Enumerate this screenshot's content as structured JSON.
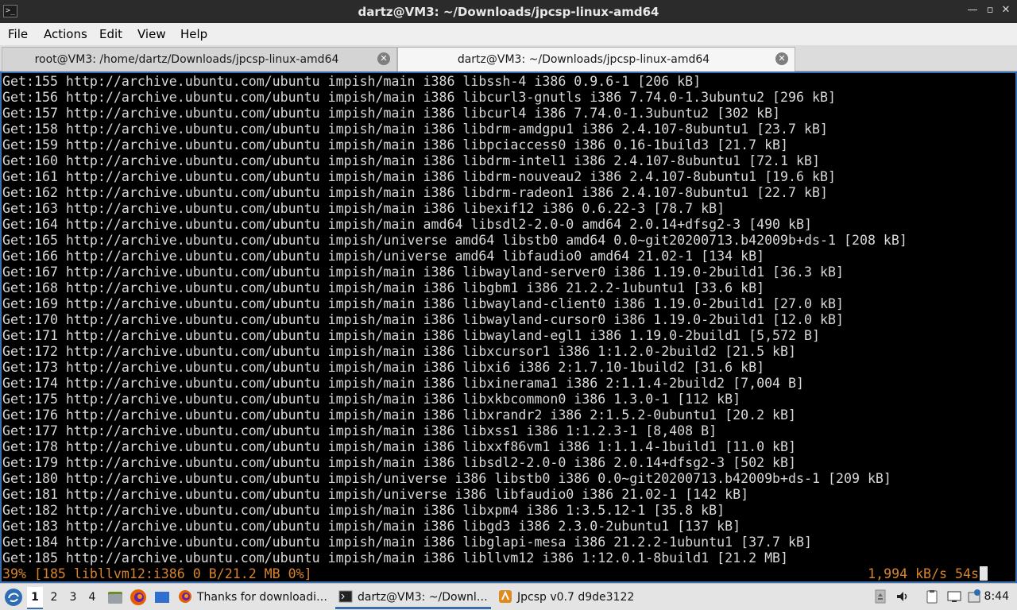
{
  "window": {
    "title": "dartz@VM3: ~/Downloads/jpcsp-linux-amd64",
    "app_icon_glyph": ">_",
    "buttons": {
      "minimize": "—",
      "maximize": "▫",
      "close": "✕"
    }
  },
  "menu": [
    "File",
    "Actions",
    "Edit",
    "View",
    "Help"
  ],
  "tabs": [
    {
      "label": "root@VM3: /home/dartz/Downloads/jpcsp-linux-amd64",
      "active": false
    },
    {
      "label": "dartz@VM3: ~/Downloads/jpcsp-linux-amd64",
      "active": true
    }
  ],
  "terminal": {
    "lines": [
      "Get:155 http://archive.ubuntu.com/ubuntu impish/main i386 libssh-4 i386 0.9.6-1 [206 kB]",
      "Get:156 http://archive.ubuntu.com/ubuntu impish/main i386 libcurl3-gnutls i386 7.74.0-1.3ubuntu2 [296 kB]",
      "Get:157 http://archive.ubuntu.com/ubuntu impish/main i386 libcurl4 i386 7.74.0-1.3ubuntu2 [302 kB]",
      "Get:158 http://archive.ubuntu.com/ubuntu impish/main i386 libdrm-amdgpu1 i386 2.4.107-8ubuntu1 [23.7 kB]",
      "Get:159 http://archive.ubuntu.com/ubuntu impish/main i386 libpciaccess0 i386 0.16-1build3 [21.7 kB]",
      "Get:160 http://archive.ubuntu.com/ubuntu impish/main i386 libdrm-intel1 i386 2.4.107-8ubuntu1 [72.1 kB]",
      "Get:161 http://archive.ubuntu.com/ubuntu impish/main i386 libdrm-nouveau2 i386 2.4.107-8ubuntu1 [19.6 kB]",
      "Get:162 http://archive.ubuntu.com/ubuntu impish/main i386 libdrm-radeon1 i386 2.4.107-8ubuntu1 [22.7 kB]",
      "Get:163 http://archive.ubuntu.com/ubuntu impish/main i386 libexif12 i386 0.6.22-3 [78.7 kB]",
      "Get:164 http://archive.ubuntu.com/ubuntu impish/main amd64 libsdl2-2.0-0 amd64 2.0.14+dfsg2-3 [490 kB]",
      "Get:165 http://archive.ubuntu.com/ubuntu impish/universe amd64 libstb0 amd64 0.0~git20200713.b42009b+ds-1 [208 kB]",
      "Get:166 http://archive.ubuntu.com/ubuntu impish/universe amd64 libfaudio0 amd64 21.02-1 [134 kB]",
      "Get:167 http://archive.ubuntu.com/ubuntu impish/main i386 libwayland-server0 i386 1.19.0-2build1 [36.3 kB]",
      "Get:168 http://archive.ubuntu.com/ubuntu impish/main i386 libgbm1 i386 21.2.2-1ubuntu1 [33.6 kB]",
      "Get:169 http://archive.ubuntu.com/ubuntu impish/main i386 libwayland-client0 i386 1.19.0-2build1 [27.0 kB]",
      "Get:170 http://archive.ubuntu.com/ubuntu impish/main i386 libwayland-cursor0 i386 1.19.0-2build1 [12.0 kB]",
      "Get:171 http://archive.ubuntu.com/ubuntu impish/main i386 libwayland-egl1 i386 1.19.0-2build1 [5,572 B]",
      "Get:172 http://archive.ubuntu.com/ubuntu impish/main i386 libxcursor1 i386 1:1.2.0-2build2 [21.5 kB]",
      "Get:173 http://archive.ubuntu.com/ubuntu impish/main i386 libxi6 i386 2:1.7.10-1build2 [31.6 kB]",
      "Get:174 http://archive.ubuntu.com/ubuntu impish/main i386 libxinerama1 i386 2:1.1.4-2build2 [7,004 B]",
      "Get:175 http://archive.ubuntu.com/ubuntu impish/main i386 libxkbcommon0 i386 1.3.0-1 [112 kB]",
      "Get:176 http://archive.ubuntu.com/ubuntu impish/main i386 libxrandr2 i386 2:1.5.2-0ubuntu1 [20.2 kB]",
      "Get:177 http://archive.ubuntu.com/ubuntu impish/main i386 libxss1 i386 1:1.2.3-1 [8,408 B]",
      "Get:178 http://archive.ubuntu.com/ubuntu impish/main i386 libxxf86vm1 i386 1:1.1.4-1build1 [11.0 kB]",
      "Get:179 http://archive.ubuntu.com/ubuntu impish/main i386 libsdl2-2.0-0 i386 2.0.14+dfsg2-3 [502 kB]",
      "Get:180 http://archive.ubuntu.com/ubuntu impish/universe i386 libstb0 i386 0.0~git20200713.b42009b+ds-1 [209 kB]",
      "Get:181 http://archive.ubuntu.com/ubuntu impish/universe i386 libfaudio0 i386 21.02-1 [142 kB]",
      "Get:182 http://archive.ubuntu.com/ubuntu impish/main i386 libxpm4 i386 1:3.5.12-1 [35.8 kB]",
      "Get:183 http://archive.ubuntu.com/ubuntu impish/main i386 libgd3 i386 2.3.0-2ubuntu1 [137 kB]",
      "Get:184 http://archive.ubuntu.com/ubuntu impish/main i386 libglapi-mesa i386 21.2.2-1ubuntu1 [37.7 kB]",
      "Get:185 http://archive.ubuntu.com/ubuntu impish/main i386 libllvm12 i386 1:12.0.1-8build1 [21.2 MB]"
    ],
    "progress_left": "39% [185 libllvm12:i386 0 B/21.2 MB 0%]",
    "progress_right": "1,994 kB/s 54s",
    "progress_color": "#d8842b"
  },
  "taskbar": {
    "start_icon": "start-menu-icon",
    "workspaces": [
      "1",
      "2",
      "3",
      "4"
    ],
    "active_workspace": 0,
    "launchers": [
      "file-manager-icon",
      "firefox-icon",
      "desktop-icon"
    ],
    "tasks": [
      {
        "label": "Thanks for downloadi…",
        "icon": "firefox-icon",
        "active": false
      },
      {
        "label": "dartz@VM3: ~/Downl…",
        "icon": "terminal-icon",
        "active": true
      },
      {
        "label": "Jpcsp v0.7 d9de3122",
        "icon": "jpcsp-icon",
        "active": false
      }
    ],
    "tray": [
      "eject-icon",
      "volume-icon",
      "clipboard-icon",
      "network-icon",
      "notification-icon"
    ],
    "clock": "8:44",
    "accent": "#3a6db0"
  }
}
